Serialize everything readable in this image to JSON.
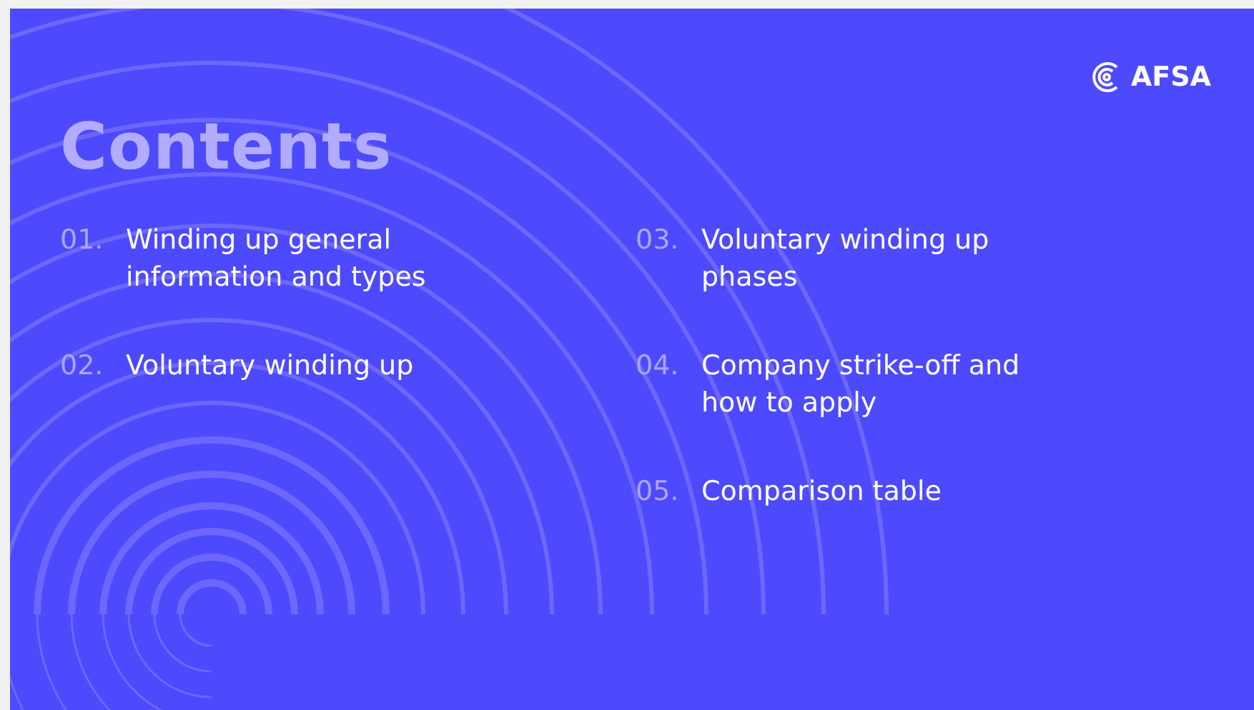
{
  "logo": {
    "text": "AFSA"
  },
  "title": "Contents",
  "columns": [
    {
      "items": [
        {
          "number": "01.",
          "text": "Winding up general information and types"
        },
        {
          "number": "02.",
          "text": "Voluntary winding up"
        }
      ]
    },
    {
      "items": [
        {
          "number": "03.",
          "text": "Voluntary winding up phases"
        },
        {
          "number": "04.",
          "text": "Company strike-off and how to apply"
        },
        {
          "number": "05.",
          "text": "Comparison table"
        }
      ]
    }
  ]
}
